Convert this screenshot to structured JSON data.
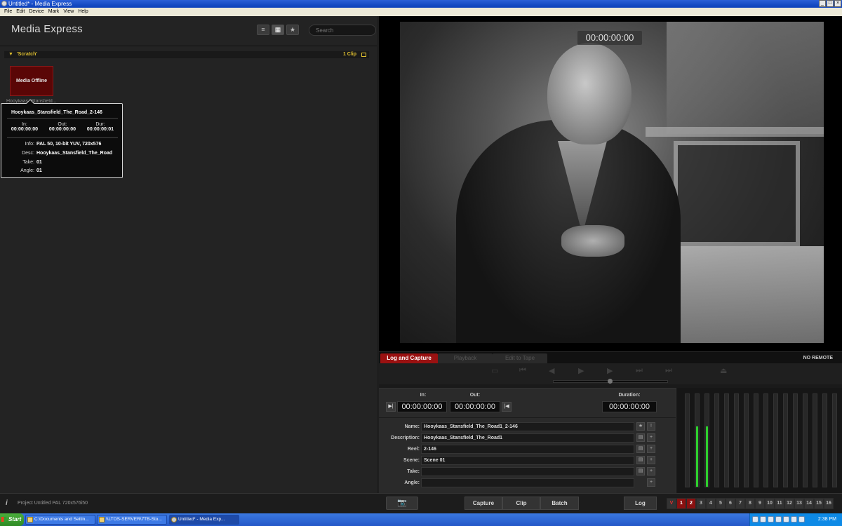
{
  "window": {
    "title": "Untitled* - Media Express",
    "controls": [
      "_",
      "□",
      "×"
    ]
  },
  "menu": [
    "File",
    "Edit",
    "Device",
    "Mark",
    "View",
    "Help"
  ],
  "app": {
    "name": "Media Express",
    "search_placeholder": "Search",
    "view_buttons": {
      "list": "≡",
      "grid": "▦",
      "favorites": "★"
    }
  },
  "bin": {
    "name": "'Scratch'",
    "count": "1 Clip",
    "clip": {
      "thumb_text": "Media Offline",
      "label": "Hooykaas_Stansfield..."
    }
  },
  "tooltip": {
    "title": "Hooykaas_Stansfield_The_Road_2-146",
    "in_label": "In:",
    "in_value": "00:00:00:00",
    "out_label": "Out:",
    "out_value": "00:00:00:00",
    "dur_label": "Dur:",
    "dur_value": "00:00:00:01",
    "info_label": "Info:",
    "info_value": "PAL 50, 10-bit YUV, 720x576",
    "desc_label": "Desc:",
    "desc_value": "Hooykaas_Stansfield_The_Road",
    "take_label": "Take:",
    "take_value": "01",
    "angle_label": "Angle:",
    "angle_value": "01"
  },
  "viewer": {
    "timecode": "00:00:00:00"
  },
  "tabs": {
    "log_capture": "Log and Capture",
    "playback": "Playback",
    "edit_to_tape": "Edit to Tape"
  },
  "remote_status": "NO REMOTE",
  "transport": [
    "▭",
    "⏮",
    "◀",
    "▶",
    "▶",
    "⏭",
    "⏭",
    "⏏"
  ],
  "capture": {
    "in_label": "In:",
    "in_value": "00:00:00:00",
    "out_label": "Out:",
    "out_value": "00:00:00:00",
    "duration_label": "Duration:",
    "duration_value": "00:00:00:00",
    "mark_in_icon": "▶|",
    "mark_out_icon": "|◀"
  },
  "fields": [
    {
      "label": "Name:",
      "value": "Hooykaas_Stansfield_The_Road1_2-146",
      "b1": "★",
      "b2": "!"
    },
    {
      "label": "Description:",
      "value": "Hooykaas_Stansfield_The_Road1",
      "b1": "▤",
      "b2": "+"
    },
    {
      "label": "Reel:",
      "value": "2-146",
      "b1": "▤",
      "b2": "+"
    },
    {
      "label": "Scene:",
      "value": "Scene 01",
      "b1": "▤",
      "b2": "+"
    },
    {
      "label": "Take:",
      "value": "",
      "b1": "▤",
      "b2": "+"
    },
    {
      "label": "Angle:",
      "value": "",
      "b1": "",
      "b2": "+"
    }
  ],
  "meters": {
    "levels": [
      0,
      0.65,
      0.65,
      0,
      0,
      0,
      0,
      0,
      0,
      0,
      0,
      0,
      0,
      0,
      0,
      0
    ]
  },
  "bottom": {
    "project_text": "Project Untitled  PAL 720x576i50",
    "capture": "Capture",
    "clip": "Clip",
    "batch": "Batch",
    "log": "Log",
    "channels": [
      "V",
      "1",
      "2",
      "3",
      "4",
      "5",
      "6",
      "7",
      "8",
      "9",
      "10",
      "11",
      "12",
      "13",
      "14",
      "15",
      "16"
    ]
  },
  "taskbar": {
    "start": "Start",
    "tasks": [
      "C:\\Documents and Settin...",
      "\\\\LTOS-SERVER\\7TB-Sto...",
      "Untitled* - Media Exp..."
    ],
    "clock": "2:38 PM"
  }
}
